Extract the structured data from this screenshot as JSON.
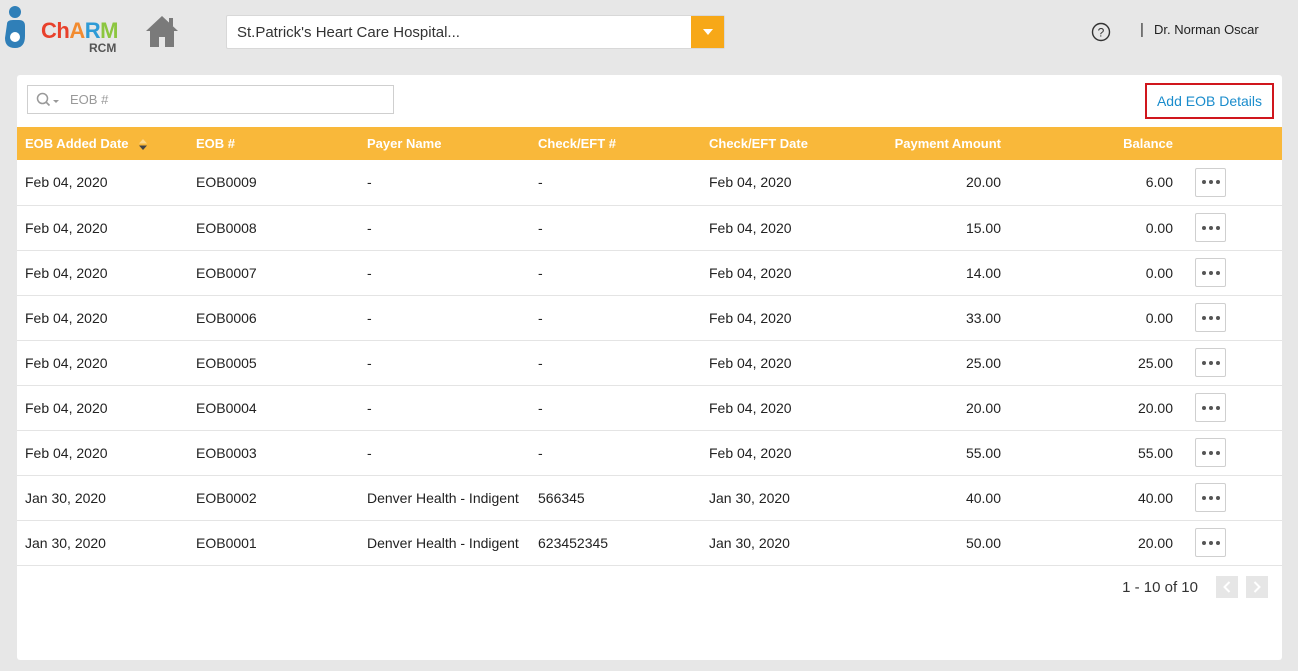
{
  "app": {
    "logo_text": "ChARM",
    "logo_sub": "RCM"
  },
  "header": {
    "hospital": "St.Patrick's Heart Care Hospital...",
    "user": "Dr. Norman Oscar",
    "separator": "|"
  },
  "toolbar": {
    "search_placeholder": "EOB #",
    "add_label": "Add EOB Details"
  },
  "colors": {
    "header_row": "#f9b83a",
    "dropdown": "#f7a818",
    "link": "#1a8ccc",
    "highlight": "#d0161d"
  },
  "table": {
    "columns": [
      "EOB Added Date",
      "EOB #",
      "Payer Name",
      "Check/EFT #",
      "Check/EFT Date",
      "Payment Amount",
      "Balance"
    ],
    "rows": [
      [
        "Feb 04, 2020",
        "EOB0009",
        "-",
        "-",
        "Feb 04, 2020",
        "20.00",
        "6.00"
      ],
      [
        "Feb 04, 2020",
        "EOB0008",
        "-",
        "-",
        "Feb 04, 2020",
        "15.00",
        "0.00"
      ],
      [
        "Feb 04, 2020",
        "EOB0007",
        "-",
        "-",
        "Feb 04, 2020",
        "14.00",
        "0.00"
      ],
      [
        "Feb 04, 2020",
        "EOB0006",
        "-",
        "-",
        "Feb 04, 2020",
        "33.00",
        "0.00"
      ],
      [
        "Feb 04, 2020",
        "EOB0005",
        "-",
        "-",
        "Feb 04, 2020",
        "25.00",
        "25.00"
      ],
      [
        "Feb 04, 2020",
        "EOB0004",
        "-",
        "-",
        "Feb 04, 2020",
        "20.00",
        "20.00"
      ],
      [
        "Feb 04, 2020",
        "EOB0003",
        "-",
        "-",
        "Feb 04, 2020",
        "55.00",
        "55.00"
      ],
      [
        "Jan 30, 2020",
        "EOB0002",
        "Denver Health - Indigent",
        "566345",
        "Jan 30, 2020",
        "40.00",
        "40.00"
      ],
      [
        "Jan 30, 2020",
        "EOB0001",
        "Denver Health - Indigent",
        "623452345",
        "Jan 30, 2020",
        "50.00",
        "20.00"
      ]
    ]
  },
  "pagination": {
    "info": "1 - 10 of 10"
  },
  "icons": {
    "home": "home-icon",
    "help": "help-icon",
    "search": "search-icon",
    "more": "more-icon",
    "prev": "chevron-left-icon",
    "next": "chevron-right-icon",
    "sort": "sort-icon",
    "dropdown": "caret-down-icon"
  }
}
